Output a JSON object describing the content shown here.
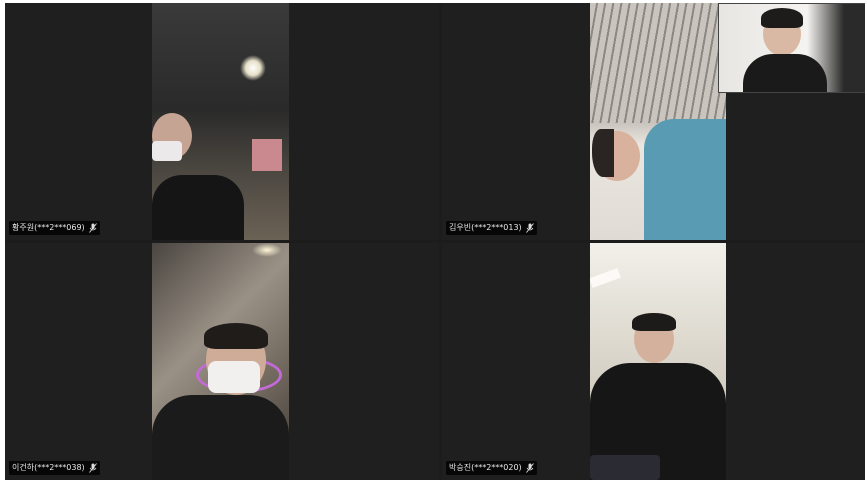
{
  "participants": [
    {
      "name": "황주원(***2***069)",
      "mic": "mic-muted-icon"
    },
    {
      "name": "김우빈(***2***013)",
      "mic": "mic-muted-icon"
    },
    {
      "name": "이건하(***2***038)",
      "mic": "mic-muted-icon"
    },
    {
      "name": "박승진(***2***020)",
      "mic": "mic-muted-icon"
    }
  ],
  "colors": {
    "stage": "#1c1c1c",
    "tile": "#1f1f1f",
    "label_bg": "#000000"
  }
}
